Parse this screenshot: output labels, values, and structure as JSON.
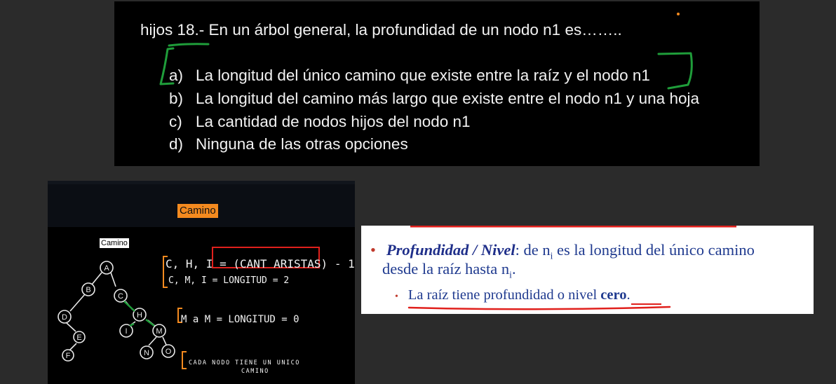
{
  "question": {
    "title": "hijos 18.- En un árbol general, la profundidad de un nodo n1 es……..",
    "options": [
      {
        "letter": "a)",
        "text": "La longitud del único camino que existe entre la raíz y el nodo n1"
      },
      {
        "letter": "b)",
        "text": "La longitud del camino más largo que existe entre el nodo n1 y una hoja"
      },
      {
        "letter": "c)",
        "text": "La cantidad de nodos hijos del nodo n1"
      },
      {
        "letter": "d)",
        "text": "Ninguna de las otras opciones"
      }
    ]
  },
  "camino": {
    "header_title": "Camino",
    "label": "Camino",
    "tree_nodes": [
      "A",
      "B",
      "C",
      "D",
      "E",
      "F",
      "H",
      "I",
      "M",
      "N",
      "O"
    ],
    "notes": [
      "C, H, I = (CANT ARISTAS) - 1",
      "C, M, I = LONGITUD = 2",
      "M a M = LONGITUD = 0",
      "CADA NODO TIENE UN UNICO",
      "CAMINO"
    ]
  },
  "definition": {
    "bullet1_term": "Profundidad / Nivel",
    "bullet1_colon": ":",
    "bullet1_pre": " de n",
    "bullet1_sub": "i",
    "bullet1_post": " es la longitud del único camino",
    "bullet2_pre": "desde la raíz hasta n",
    "bullet2_sub": "i",
    "bullet2_post": ".",
    "sub_pre": "La raíz tiene profundidad o nivel ",
    "sub_bold": "cero",
    "sub_post": "."
  },
  "colors": {
    "background": "#2b2b2b",
    "accent_orange": "#f48a1f",
    "ink_green": "#1f9d3a",
    "ink_red": "#e0201c",
    "text_blue": "#1f3a8f"
  }
}
